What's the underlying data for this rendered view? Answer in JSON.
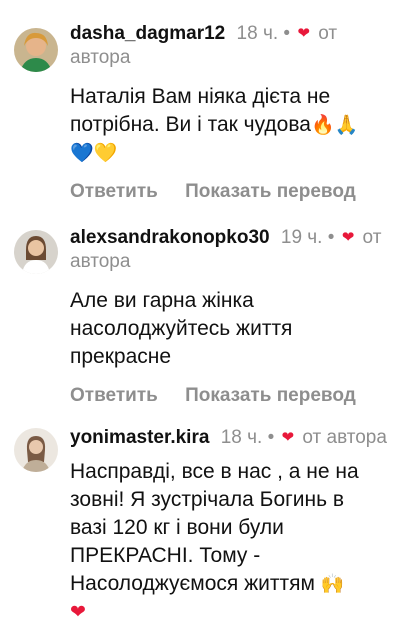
{
  "comments": [
    {
      "username": "dasha_dagmar12",
      "time": "18 ч.",
      "dot": "•",
      "from_author": "от",
      "from_author_2": "автора",
      "text_line1": "Наталія Вам ніяка дієта не",
      "text_line2": "потрібна. Ви і так чудова",
      "reply": "Ответить",
      "translate": "Показать перевод"
    },
    {
      "username": "alexsandrakonopko30",
      "time": "19 ч.",
      "dot": "•",
      "from_author": "от",
      "from_author_2": "автора",
      "text_line1": "Але ви гарна жінка",
      "text_line2": "насолоджуйтесь життя",
      "text_line3": "прекрасне",
      "reply": "Ответить",
      "translate": "Показать перевод"
    },
    {
      "username": "yonimaster.kira",
      "time": "18 ч.",
      "dot": "•",
      "from_author": "от автора",
      "text_line1": "Насправді, все в нас , а не на",
      "text_line2": "зовні! Я зустрічала Богинь в",
      "text_line3": "вазі 120 кг і вони були",
      "text_line4": "ПРЕКРАСНІ.  Тому -",
      "text_line5": "Насолоджуємося життям"
    }
  ],
  "icons": {
    "author_heart": "red-heart-icon",
    "emojis": [
      "fire",
      "folded-hands",
      "blue-heart",
      "yellow-heart",
      "raising-hands",
      "red-heart"
    ]
  }
}
